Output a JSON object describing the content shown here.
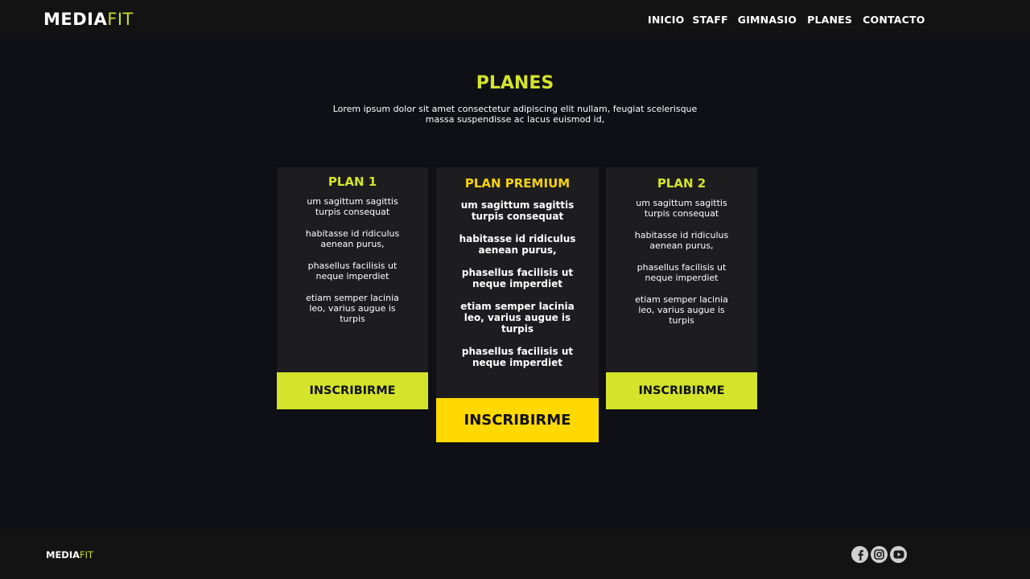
{
  "header": {
    "logo": {
      "main": "MEDIA",
      "accent": "FIT"
    },
    "nav": [
      "INICIO",
      "STAFF",
      "GIMNASIO",
      "PLANES",
      "CONTACTO"
    ]
  },
  "section": {
    "title": "PLANES",
    "description": "Lorem ipsum dolor sit amet consectetur adipiscing elit nullam, feugiat scelerisque massa suspendisse ac lacus euismod id,"
  },
  "plans": [
    {
      "title": "PLAN 1",
      "features": [
        "um sagittum sagittis turpis consequat",
        "habitasse id ridiculus aenean purus,",
        "phasellus facilisis ut neque imperdiet",
        "etiam semper lacinia leo, varius augue is turpis"
      ],
      "button": "INSCRIBIRME"
    },
    {
      "title": "PLAN PREMIUM",
      "features": [
        "um sagittum sagittis turpis consequat",
        "habitasse id ridiculus aenean purus,",
        "phasellus facilisis ut neque imperdiet",
        "etiam semper lacinia leo, varius augue is turpis",
        "phasellus facilisis ut neque imperdiet"
      ],
      "button": "INSCRIBIRME"
    },
    {
      "title": "PLAN 2",
      "features": [
        "um sagittum sagittis turpis consequat",
        "habitasse id ridiculus aenean purus,",
        "phasellus facilisis ut neque imperdiet",
        "etiam semper lacinia leo, varius augue is turpis"
      ],
      "button": "INSCRIBIRME"
    }
  ],
  "footer": {
    "logo": {
      "main": "MEDIA",
      "accent": "FIT"
    },
    "socials": [
      "facebook-icon",
      "instagram-icon",
      "youtube-icon"
    ]
  },
  "colors": {
    "background": "#0f1015",
    "bar": "#131313",
    "card": "#1d1d1f",
    "accent_lime": "#d4e42a",
    "accent_yellow": "#ffd900"
  }
}
